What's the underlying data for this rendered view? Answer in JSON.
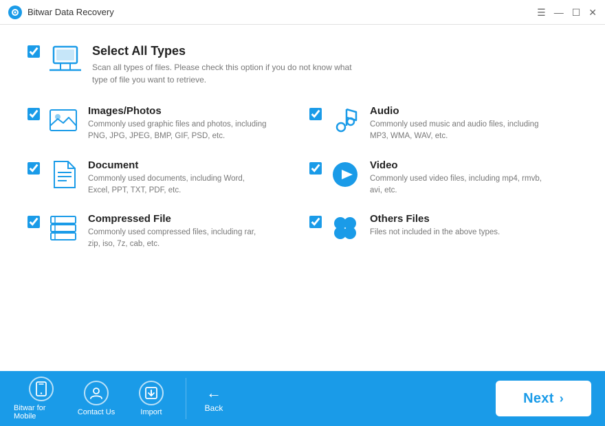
{
  "titlebar": {
    "title": "Bitwar Data Recovery",
    "controls": {
      "menu": "☰",
      "minimize": "—",
      "maximize": "☐",
      "close": "✕"
    }
  },
  "select_all": {
    "title": "Select All Types",
    "desc": "Scan all types of files. Please check this option if you do not know what type of file you want to retrieve.",
    "checked": true
  },
  "file_types": [
    {
      "id": "images",
      "title": "Images/Photos",
      "desc": "Commonly used graphic files and photos, including PNG, JPG, JPEG, BMP, GIF, PSD, etc.",
      "checked": true
    },
    {
      "id": "audio",
      "title": "Audio",
      "desc": "Commonly used music and audio files, including MP3, WMA, WAV, etc.",
      "checked": true
    },
    {
      "id": "document",
      "title": "Document",
      "desc": "Commonly used documents, including Word, Excel, PPT, TXT, PDF, etc.",
      "checked": true
    },
    {
      "id": "video",
      "title": "Video",
      "desc": "Commonly used video files, including mp4, rmvb, avi, etc.",
      "checked": true
    },
    {
      "id": "compressed",
      "title": "Compressed File",
      "desc": "Commonly used compressed files, including rar, zip, iso, 7z, cab, etc.",
      "checked": true
    },
    {
      "id": "others",
      "title": "Others Files",
      "desc": "Files not included in the above types.",
      "checked": true
    }
  ],
  "bottom": {
    "mobile_label": "Bitwar for Mobile",
    "contact_label": "Contact Us",
    "import_label": "Import",
    "back_label": "Back",
    "next_label": "Next"
  }
}
